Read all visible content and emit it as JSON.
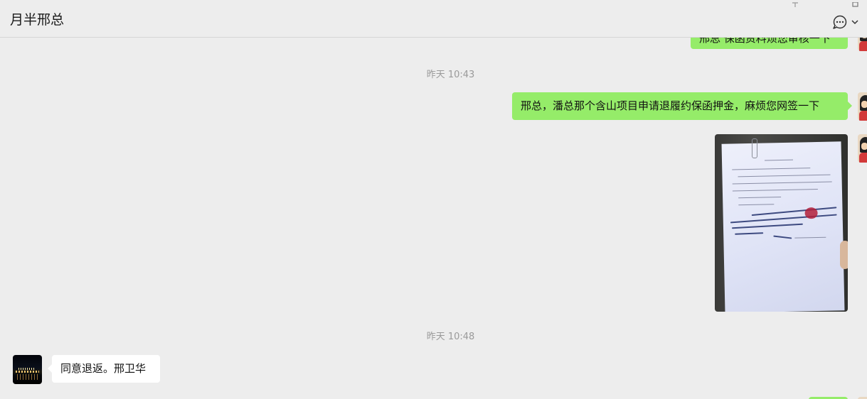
{
  "header": {
    "title": "月半邢总"
  },
  "messages": {
    "partial_top": "邢总 保函资料烦您审核一下",
    "time1": "昨天 10:43",
    "msg1": "邢总，潘总那个含山项目申请退履约保函押金，麻烦您网签一下",
    "time2": "昨天 10:48",
    "msg2": "同意退返。邢卫华"
  },
  "colors": {
    "bg": "#ededed",
    "bubble_me": "#95ec69",
    "bubble_other": "#ffffff"
  },
  "icons": {
    "more": "chat-bubble-ellipsis-icon",
    "dropdown": "chevron-down-icon"
  }
}
